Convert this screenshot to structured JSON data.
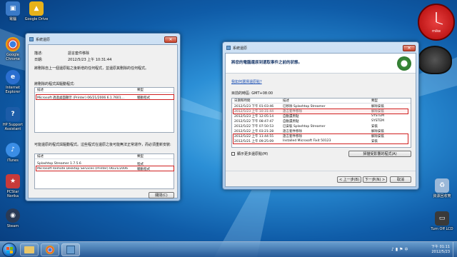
{
  "desktop": {
    "icons": [
      {
        "label": "電腦",
        "color": "#3a7ac8"
      },
      {
        "label": "Google Drive",
        "color": "#e8b21a"
      },
      {
        "label": "Google Chrome",
        "color": "#2e9c47"
      },
      {
        "label": "Internet Explorer",
        "color": "#2b6fd0"
      },
      {
        "label": "HP Support Assistant",
        "color": "#1c5ca8"
      },
      {
        "label": "iTunes",
        "color": "#3b8ee6"
      },
      {
        "label": "PCStar Norika",
        "color": "#c83a3a"
      },
      {
        "label": "Steam",
        "color": "#2a3a55"
      },
      {
        "label": "資源回收筒",
        "color": "#9bb8d8"
      },
      {
        "label": "Turn Off LCD",
        "color": "#3a3a3a"
      }
    ],
    "gadget_label": "mike"
  },
  "left_window": {
    "title": "系統還原",
    "desc_label": "描述:",
    "desc_value": "語言套件移除",
    "date_label": "日期:",
    "date_value": "2012/5/23 上午 10:31:44",
    "info1": "將刪除自上一個還原點之後新增的任何程式，並還原其刪除的任何程式。",
    "section1_title": "將刪除的程式與驅動程式:",
    "section2_title": "可能還原的程式與驅動程式。這些程式在還原之後可能無法正常運作，而必須重新安裝:",
    "col_desc": "描述",
    "col_type": "類型",
    "list1_rows": [
      {
        "desc": "Microsoft 透過桌面顯示 (Printer) 06/21/2006 6.1.7601...",
        "type": "驅動程式"
      }
    ],
    "list2_rows": [
      {
        "desc": "Splashtop Streamer 1.7.5.6",
        "type": "程式"
      },
      {
        "desc": "Microsoft Remote Desktop Services (Printer) 06/21/2006",
        "type": "驅動程式"
      }
    ],
    "close_btn": "關閉(C)"
  },
  "right_window": {
    "title": "系統還原",
    "heading": "將您的電腦還原到選取事件之前的狀態。",
    "link_text": "我如何選擇還原點?",
    "timezone": "目前的時區: GMT+08:00",
    "col_date": "日期和時間",
    "col_desc": "描述",
    "col_type": "類型",
    "rows": [
      {
        "date": "2012/5/23 下午 01:03:46",
        "desc": "已移除 Splashtop Streamer",
        "type": "解除安裝"
      },
      {
        "date": "2012/5/23 上午 10:31:44",
        "desc": "語言套件移除",
        "type": "解除安裝"
      },
      {
        "date": "2012/5/23 上午 12:05:14",
        "desc": "自動還原點",
        "type": "SYSTEM"
      },
      {
        "date": "2012/5/22 下午 08:47:47",
        "desc": "自動還原點",
        "type": "SYSTEM"
      },
      {
        "date": "2012/5/22 下午 07:50:53",
        "desc": "已安裝 Splashtop Streamer",
        "type": "安裝"
      },
      {
        "date": "2012/5/22 上午 03:21:28",
        "desc": "語言套件移除",
        "type": "解除安裝"
      },
      {
        "date": "2012/5/22 上午 11:44:55",
        "desc": "語言套件移除",
        "type": "解除安裝"
      },
      {
        "date": "2012/5/21 上午 09:25:09",
        "desc": "Installed Microsoft Fixit 50123",
        "type": "安裝"
      }
    ],
    "show_more": "顯示更多還原點(M)",
    "scan_btn": "掃描受影響的程式(A)",
    "back_btn": "< 上一步(B)",
    "next_btn": "下一步(N) >",
    "cancel_btn": "取消"
  },
  "taskbar": {
    "time": "下午 01:11",
    "date": "2012/5/23",
    "lang": "中"
  }
}
